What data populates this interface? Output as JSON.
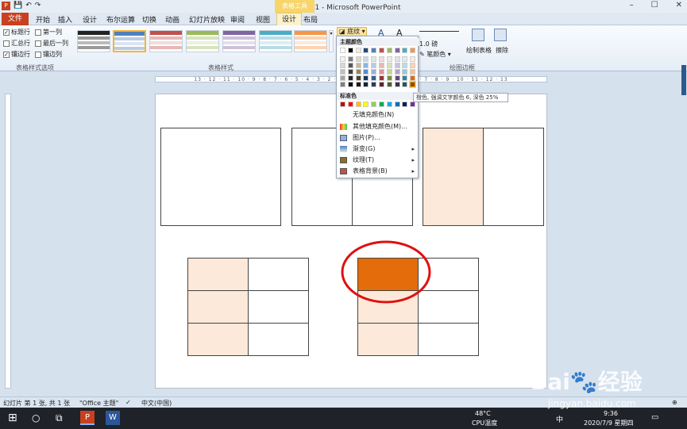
{
  "titlebar": {
    "title": "演示文稿1 - Microsoft PowerPoint",
    "contextual_tab": "表格工具"
  },
  "tabs": {
    "file": "文件",
    "items": [
      "开始",
      "插入",
      "设计",
      "布尔运算",
      "切换",
      "动画",
      "幻灯片放映",
      "审阅",
      "视图"
    ],
    "context": [
      "设计",
      "布局"
    ]
  },
  "ribbon": {
    "options": {
      "header_row": "标题行",
      "first_column": "第一列",
      "total_row": "汇总行",
      "last_column": "最后一列",
      "banded_rows": "镶边行",
      "banded_columns": "镶边列",
      "group_label": "表格样式选项"
    },
    "styles_group_label": "表格样式",
    "shading_label": "底纹",
    "border_weight": "1.0  磅",
    "pen_color": "笔颜色",
    "draw_table": "绘制表格",
    "eraser": "擦除",
    "borders_group_label": "绘图边框"
  },
  "ruler_text": "13 · 12 · 11 · 10 · 9 · 8 · 7 · 6 · 5 · 4 · 3 · 2 · 1 · 0 · 1 · 2 · 3 · 4 · 5 · 6 · 7 · 8 · 9 · 10 · 11 · 12 · 13",
  "dropdown": {
    "theme_colors_label": "主题颜色",
    "standard_colors_label": "标准色",
    "items": [
      {
        "label": "无填充颜色(N)",
        "icon": "none",
        "arrow": ""
      },
      {
        "label": "其他填充颜色(M)...",
        "icon": "palette-icon",
        "arrow": ""
      },
      {
        "label": "图片(P)...",
        "icon": "picture-icon",
        "arrow": ""
      },
      {
        "label": "渐变(G)",
        "icon": "gradient-icon",
        "arrow": "▸"
      },
      {
        "label": "纹理(T)",
        "icon": "texture-icon",
        "arrow": "▸"
      },
      {
        "label": "表格背景(B)",
        "icon": "table-background-icon",
        "arrow": "▸"
      }
    ],
    "tooltip": "橙色, 强调文字颜色 6, 深色 25%"
  },
  "statusbar": {
    "slide": "幻灯片 第 1 张, 共 1 张",
    "theme": "\"Office 主题\"",
    "language": "中文(中国)"
  },
  "taskbar": {
    "temp": "48°C",
    "cpu": "CPU温度",
    "ime": "中",
    "time": "9:36",
    "date": "2020/7/9 星期四"
  },
  "watermark": {
    "brand": "Bai",
    "brand2": "经验",
    "url": "jingyan.baidu.com"
  },
  "colors": {
    "accent_orange": "#e46c0a",
    "light_peach": "#fde9d9",
    "annotation_red": "#e01010"
  }
}
